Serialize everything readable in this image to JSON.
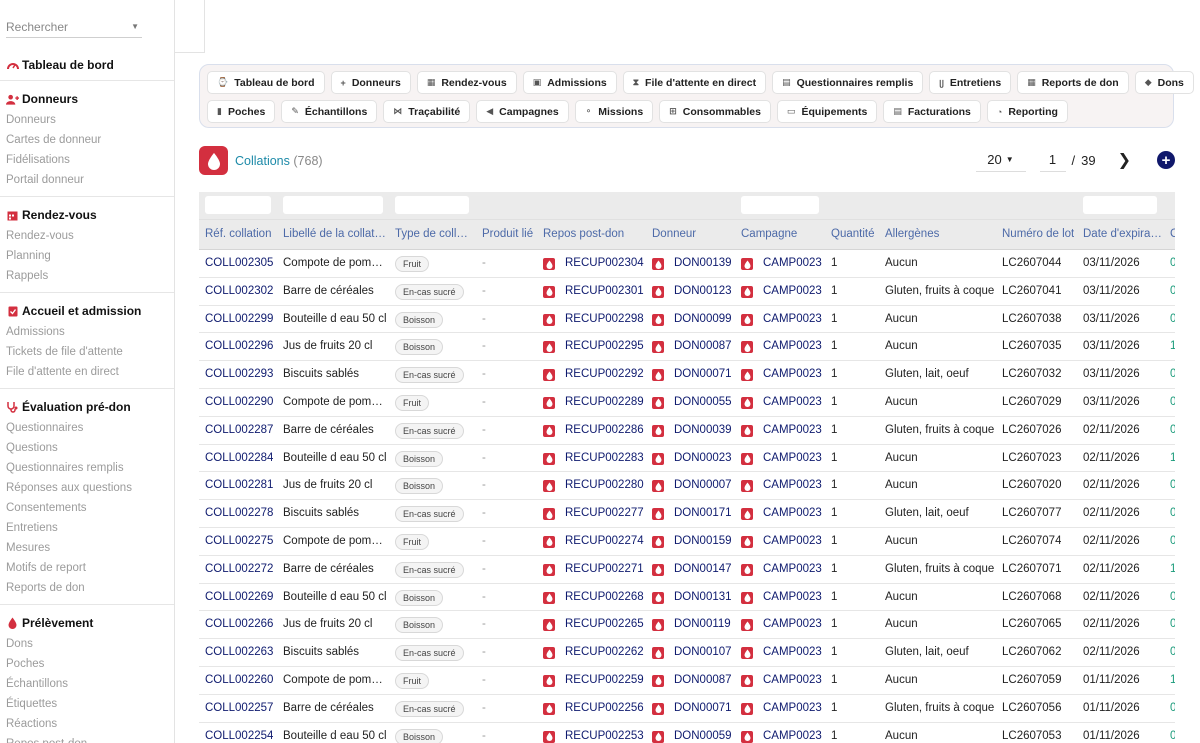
{
  "sidebar": {
    "search_placeholder": "Rechercher",
    "sections": [
      {
        "title": "Tableau de bord",
        "icon": "gauge-icon",
        "items": []
      },
      {
        "title": "Donneurs",
        "icon": "add-user-icon",
        "items": [
          "Donneurs",
          "Cartes de donneur",
          "Fidélisations",
          "Portail donneur"
        ]
      },
      {
        "title": "Rendez-vous",
        "icon": "calendar-icon",
        "items": [
          "Rendez-vous",
          "Planning",
          "Rappels"
        ]
      },
      {
        "title": "Accueil et admission",
        "icon": "clipboard-icon",
        "items": [
          "Admissions",
          "Tickets de file d'attente",
          "File d'attente en direct"
        ]
      },
      {
        "title": "Évaluation pré-don",
        "icon": "stethoscope-icon",
        "items": [
          "Questionnaires",
          "Questions",
          "Questionnaires remplis",
          "Réponses aux questions",
          "Consentements",
          "Entretiens",
          "Mesures",
          "Motifs de report",
          "Reports de don"
        ]
      },
      {
        "title": "Prélèvement",
        "icon": "drop-icon",
        "items": [
          "Dons",
          "Poches",
          "Échantillons",
          "Étiquettes",
          "Réactions",
          "Repos post-don"
        ]
      }
    ]
  },
  "nav": {
    "row1": [
      {
        "label": "Tableau de bord",
        "icon": "⌚"
      },
      {
        "label": "Donneurs",
        "icon": "+"
      },
      {
        "label": "Rendez-vous",
        "icon": "▦"
      },
      {
        "label": "Admissions",
        "icon": "▣"
      },
      {
        "label": "File d'attente en direct",
        "icon": "⧗"
      },
      {
        "label": "Questionnaires remplis",
        "icon": "▤"
      },
      {
        "label": "Entretiens",
        "icon": "ᥩ"
      },
      {
        "label": "Reports de don",
        "icon": "▦"
      },
      {
        "label": "Dons",
        "icon": "◆"
      }
    ],
    "row2": [
      {
        "label": "Poches",
        "icon": "▮"
      },
      {
        "label": "Échantillons",
        "icon": "✎"
      },
      {
        "label": "Traçabilité",
        "icon": "⋈"
      },
      {
        "label": "Campagnes",
        "icon": "◀"
      },
      {
        "label": "Missions",
        "icon": "⚬"
      },
      {
        "label": "Consommables",
        "icon": "⊞"
      },
      {
        "label": "Équipements",
        "icon": "▭"
      },
      {
        "label": "Facturations",
        "icon": "▤"
      },
      {
        "label": "Reporting",
        "icon": "◔"
      }
    ]
  },
  "header": {
    "title": "Collations",
    "count": "(768)",
    "page_size": "20",
    "page": "1",
    "page_sep": "/",
    "total_pages": "39",
    "next": "❯",
    "add": "+"
  },
  "table": {
    "columns": [
      "Réf. collation",
      "Libellé de la collation",
      "Type de collation",
      "Produit lié",
      "Repos post-don",
      "Donneur",
      "Campagne",
      "Quantité",
      "Allergènes",
      "Numéro de lot",
      "Date d'expiration",
      "C"
    ],
    "rows": [
      [
        "COLL002305",
        "Compote de pomme",
        "Fruit",
        "-",
        "RECUP002304",
        "DON00139",
        "CAMP0023",
        "1",
        "Aucun",
        "LC2607044",
        "03/11/2026",
        "0"
      ],
      [
        "COLL002302",
        "Barre de céréales",
        "En-cas sucré",
        "-",
        "RECUP002301",
        "DON00123",
        "CAMP0023",
        "1",
        "Gluten, fruits à coque",
        "LC2607041",
        "03/11/2026",
        "0"
      ],
      [
        "COLL002299",
        "Bouteille d eau 50 cl",
        "Boisson",
        "-",
        "RECUP002298",
        "DON00099",
        "CAMP0023",
        "1",
        "Aucun",
        "LC2607038",
        "03/11/2026",
        "0"
      ],
      [
        "COLL002296",
        "Jus de fruits 20 cl",
        "Boisson",
        "-",
        "RECUP002295",
        "DON00087",
        "CAMP0023",
        "1",
        "Aucun",
        "LC2607035",
        "03/11/2026",
        "1"
      ],
      [
        "COLL002293",
        "Biscuits sablés",
        "En-cas sucré",
        "-",
        "RECUP002292",
        "DON00071",
        "CAMP0023",
        "1",
        "Gluten, lait, oeuf",
        "LC2607032",
        "03/11/2026",
        "0"
      ],
      [
        "COLL002290",
        "Compote de pomme",
        "Fruit",
        "-",
        "RECUP002289",
        "DON00055",
        "CAMP0023",
        "1",
        "Aucun",
        "LC2607029",
        "03/11/2026",
        "0"
      ],
      [
        "COLL002287",
        "Barre de céréales",
        "En-cas sucré",
        "-",
        "RECUP002286",
        "DON00039",
        "CAMP0023",
        "1",
        "Gluten, fruits à coque",
        "LC2607026",
        "02/11/2026",
        "0"
      ],
      [
        "COLL002284",
        "Bouteille d eau 50 cl",
        "Boisson",
        "-",
        "RECUP002283",
        "DON00023",
        "CAMP0023",
        "1",
        "Aucun",
        "LC2607023",
        "02/11/2026",
        "1"
      ],
      [
        "COLL002281",
        "Jus de fruits 20 cl",
        "Boisson",
        "-",
        "RECUP002280",
        "DON00007",
        "CAMP0023",
        "1",
        "Aucun",
        "LC2607020",
        "02/11/2026",
        "0"
      ],
      [
        "COLL002278",
        "Biscuits sablés",
        "En-cas sucré",
        "-",
        "RECUP002277",
        "DON00171",
        "CAMP0023",
        "1",
        "Gluten, lait, oeuf",
        "LC2607077",
        "02/11/2026",
        "0"
      ],
      [
        "COLL002275",
        "Compote de pomme",
        "Fruit",
        "-",
        "RECUP002274",
        "DON00159",
        "CAMP0023",
        "1",
        "Aucun",
        "LC2607074",
        "02/11/2026",
        "0"
      ],
      [
        "COLL002272",
        "Barre de céréales",
        "En-cas sucré",
        "-",
        "RECUP002271",
        "DON00147",
        "CAMP0023",
        "1",
        "Gluten, fruits à coque",
        "LC2607071",
        "02/11/2026",
        "1"
      ],
      [
        "COLL002269",
        "Bouteille d eau 50 cl",
        "Boisson",
        "-",
        "RECUP002268",
        "DON00131",
        "CAMP0023",
        "1",
        "Aucun",
        "LC2607068",
        "02/11/2026",
        "0"
      ],
      [
        "COLL002266",
        "Jus de fruits 20 cl",
        "Boisson",
        "-",
        "RECUP002265",
        "DON00119",
        "CAMP0023",
        "1",
        "Aucun",
        "LC2607065",
        "02/11/2026",
        "0"
      ],
      [
        "COLL002263",
        "Biscuits sablés",
        "En-cas sucré",
        "-",
        "RECUP002262",
        "DON00107",
        "CAMP0023",
        "1",
        "Gluten, lait, oeuf",
        "LC2607062",
        "02/11/2026",
        "0"
      ],
      [
        "COLL002260",
        "Compote de pomme",
        "Fruit",
        "-",
        "RECUP002259",
        "DON00087",
        "CAMP0023",
        "1",
        "Aucun",
        "LC2607059",
        "01/11/2026",
        "1"
      ],
      [
        "COLL002257",
        "Barre de céréales",
        "En-cas sucré",
        "-",
        "RECUP002256",
        "DON00071",
        "CAMP0023",
        "1",
        "Gluten, fruits à coque",
        "LC2607056",
        "01/11/2026",
        "0"
      ],
      [
        "COLL002254",
        "Bouteille d eau 50 cl",
        "Boisson",
        "-",
        "RECUP002253",
        "DON00059",
        "CAMP0023",
        "1",
        "Aucun",
        "LC2607053",
        "01/11/2026",
        "0"
      ]
    ]
  },
  "colors": {
    "accent": "#d32f3f",
    "link": "#0e1a6e",
    "header_text": "#4d6aa8",
    "title": "#1d8aa8",
    "add_button": "#10186b"
  }
}
